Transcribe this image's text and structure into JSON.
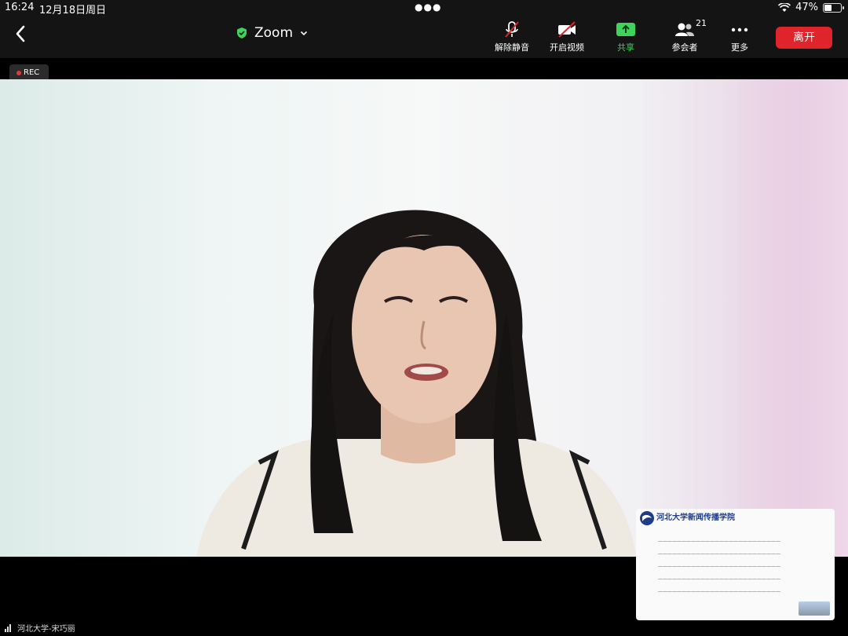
{
  "status": {
    "time": "16:24",
    "date": "12月18日周日",
    "battery": "47%",
    "battery_level": 0.47
  },
  "toolbar": {
    "title": "Zoom",
    "mute_label": "解除静音",
    "video_label": "开启视频",
    "share_label": "共享",
    "participants_label": "参会者",
    "participants_count": "21",
    "more_label": "更多",
    "leave_label": "离开"
  },
  "recording": {
    "label": "REC"
  },
  "speaker": {
    "name": "河北大学-宋巧丽"
  },
  "slide": {
    "org": "河北大学新闻传播学院"
  },
  "colors": {
    "leave": "#e0242b",
    "share": "#3fd35b",
    "shield": "#3fd35b"
  }
}
